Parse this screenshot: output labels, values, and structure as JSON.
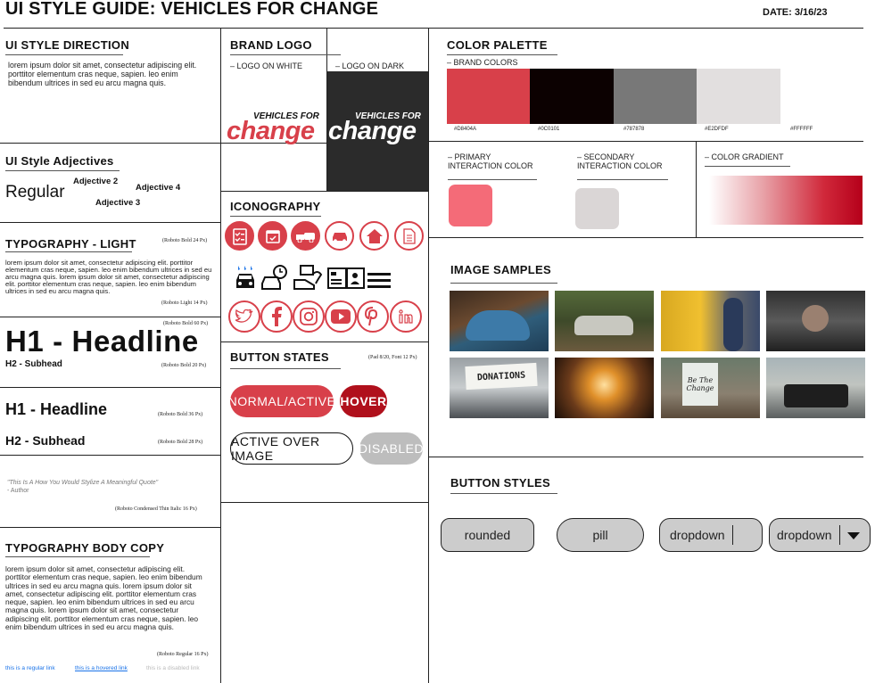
{
  "header": {
    "title": "UI STYLE GUIDE: VEHICLES FOR CHANGE",
    "date": "DATE: 3/16/23"
  },
  "style_direction": {
    "title": "UI STYLE DIRECTION",
    "body": "lorem ipsum dolor sit amet, consectetur adipiscing elit. porttitor elementum cras neque, sapien. leo enim bibendum ultrices in sed eu arcu magna quis."
  },
  "adjectives": {
    "title": "UI Style Adjectives",
    "regular": "Regular",
    "adj2": "Adjective 2",
    "adj3": "Adjective 3",
    "adj4": "Adjective 4"
  },
  "typography_light": {
    "title": "TYPOGRAPHY - LIGHT",
    "title_note": "(Roboto Bold 24 Px)",
    "body": "lorem ipsum dolor sit amet, consectetur adipiscing elit. porttitor elementum cras neque, sapien. leo enim bibendum ultrices in sed eu arcu magna quis. lorem ipsum dolor sit amet, consectetur adipiscing elit. porttitor elementum cras neque, sapien. leo enim bibendum ultrices in sed eu arcu magna quis.",
    "body_note": "(Roboto Light 14 Px)",
    "h1_note": "(Roboto Bold 60 Px)",
    "h1": "H1 - Headline",
    "h2": "H2 - Subhead",
    "h2_note": "(Roboto Bold 20 Px)",
    "h1_small": "H1 - Headline",
    "h1_small_note": "(Roboto Bold 36 Px)",
    "h2_small": "H2 - Subhead",
    "h2_small_note": "(Roboto Bold 28 Px)",
    "quote": "\"This Is A How You Would Stylize A Meaningful Quote\"",
    "quote_author": "- Author",
    "quote_note": "(Roboto Condensed Thin Italic 16 Px)"
  },
  "body_copy": {
    "title": "TYPOGRAPHY BODY COPY",
    "body": "lorem ipsum dolor sit amet, consectetur adipiscing elit. porttitor elementum cras neque, sapien. leo enim bibendum ultrices in sed eu arcu magna quis. lorem ipsum dolor sit amet, consectetur adipiscing elit. porttitor elementum cras neque, sapien. leo enim bibendum ultrices in sed eu arcu magna quis. lorem ipsum dolor sit amet, consectetur adipiscing elit. porttitor elementum cras neque, sapien. leo enim bibendum ultrices in sed eu arcu magna quis.",
    "note": "(Roboto Regular 16 Px)",
    "link_regular": "this is a regular link",
    "link_hovered": "this is a hovered link",
    "link_disabled": "this is a disabled link"
  },
  "brand_logo": {
    "title": "BRAND LOGO",
    "on_white": "– LOGO ON WHITE",
    "on_dark": "– LOGO ON DARK",
    "logo_top": "VEHICLES FOR",
    "logo_bottom": "change"
  },
  "iconography": {
    "title": "ICONOGRAPHY",
    "row1": [
      "checklist-icon",
      "calendar-icon",
      "tow-truck-icon",
      "car-icon",
      "home-icon",
      "document-icon"
    ],
    "row2": [
      "car-wash-icon",
      "car-repair-icon",
      "donate-car-icon",
      "id-card-icon",
      "menu-icon"
    ],
    "row3": [
      "twitter-icon",
      "facebook-icon",
      "instagram-icon",
      "youtube-icon",
      "pinterest-icon",
      "linkedin-icon"
    ]
  },
  "button_states": {
    "title": "BUTTON STATES",
    "note": "(Pad 8/20, Font 12 Px)",
    "normal": "NORMAL/ACTIVE",
    "hover": "HOVER",
    "over_image": "ACTIVE OVER IMAGE",
    "disabled": "DISABLED"
  },
  "color_palette": {
    "title": "COLOR PALETTE",
    "brand_colors": "– BRAND COLORS",
    "swatches": [
      {
        "hex": "#D8404A",
        "label": "#D8404A"
      },
      {
        "hex": "#0C0101",
        "label": "#0C0101"
      },
      {
        "hex": "#787878",
        "label": "#787878"
      },
      {
        "hex": "#E2DFDF",
        "label": "#E2DFDF"
      },
      {
        "hex": "#FFFFFF",
        "label": "#FFFFFF"
      }
    ],
    "primary_label": "– PRIMARY INTERACTION COLOR",
    "primary_color": "#F46B78",
    "secondary_label": "– SECONDARY INTERACTION COLOR",
    "secondary_color": "#DAD6D6",
    "gradient_label": "– COLOR GRADIENT"
  },
  "image_samples": {
    "title": "IMAGE SAMPLES",
    "donations_sign": "DONATIONS",
    "be_the_change": "Be The Change"
  },
  "button_styles": {
    "title": "BUTTON STYLES",
    "rounded": "rounded",
    "pill": "pill",
    "dropdown1": "dropdown",
    "dropdown2": "dropdown"
  }
}
